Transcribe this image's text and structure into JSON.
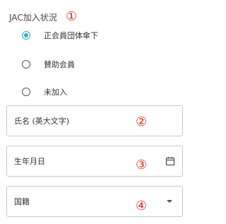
{
  "jac_section": {
    "label": "JAC加入状況",
    "marker": "①",
    "options": [
      {
        "label": "正会員団体傘下",
        "selected": true
      },
      {
        "label": "賛助会員",
        "selected": false
      },
      {
        "label": "未加入",
        "selected": false
      }
    ]
  },
  "name_field": {
    "placeholder": "氏名 (英大文字)",
    "marker": "②"
  },
  "birthdate_field": {
    "placeholder": "生年月日",
    "marker": "③",
    "icon": "calendar-icon"
  },
  "nationality_field": {
    "placeholder": "国籍",
    "marker": "④",
    "icon": "chevron-down-icon"
  },
  "colors": {
    "accent": "#2bb0c5",
    "marker": "#d9301f",
    "border": "#c8c8c8"
  }
}
